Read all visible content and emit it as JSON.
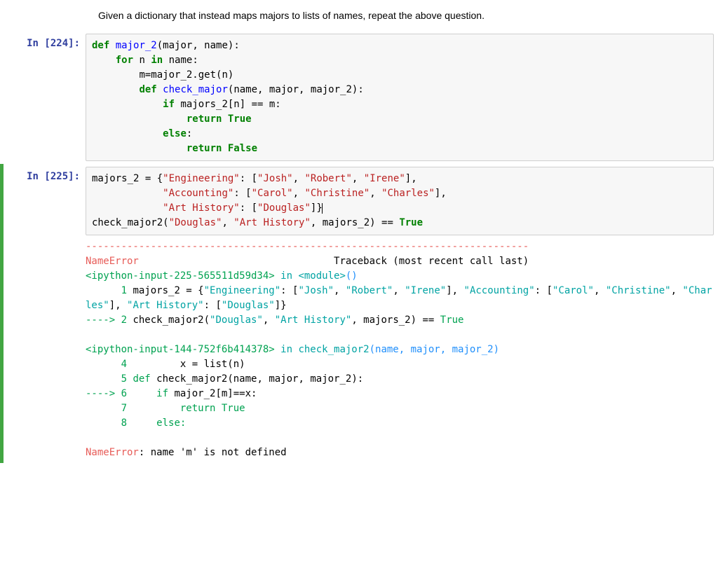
{
  "text_cell": "Given a dictionary that instead maps majors to lists of names, repeat the above question.",
  "cell224": {
    "prompt_label": "In [",
    "prompt_num": "224",
    "prompt_close": "]:",
    "line1": {
      "def": "def",
      "fn": "major_2",
      "rest": "(major, name):"
    },
    "line2": {
      "for": "for",
      "n": "n",
      "in": "in",
      "rest": " name:"
    },
    "line3": "m=major_2.get(n)",
    "line4": {
      "def": "def",
      "fn": "check_major",
      "rest": "(name, major, major_2):"
    },
    "line5": {
      "if": "if",
      "rest": " majors_2[n] == m:"
    },
    "line6": {
      "ret": "return",
      "true": "True"
    },
    "line7": {
      "else": "else",
      "colon": ":"
    },
    "line8": {
      "ret": "return",
      "false": "False"
    }
  },
  "cell225": {
    "prompt_label": "In [",
    "prompt_num": "225",
    "prompt_close": "]:",
    "l1_a": "majors_2 = {",
    "l1_eng": "\"Engineering\"",
    "l1_sep": ": [",
    "l1_josh": "\"Josh\"",
    "l1_c1": ", ",
    "l1_rob": "\"Robert\"",
    "l1_c2": ", ",
    "l1_ire": "\"Irene\"",
    "l1_end": "],",
    "l2_pad": "            ",
    "l2_acc": "\"Accounting\"",
    "l2_sep": ": [",
    "l2_car": "\"Carol\"",
    "l2_c1": ", ",
    "l2_chr": "\"Christine\"",
    "l2_c2": ", ",
    "l2_cha": "\"Charles\"",
    "l2_end": "],",
    "l3_pad": "            ",
    "l3_art": "\"Art History\"",
    "l3_sep": ": [",
    "l3_dou": "\"Douglas\"",
    "l3_end": "]}",
    "l4_a": "check_major2(",
    "l4_dou": "\"Douglas\"",
    "l4_c1": ", ",
    "l4_art": "\"Art History\"",
    "l4_rest": ", majors_2) == ",
    "l4_true": "True"
  },
  "tb": {
    "dashes": "---------------------------------------------------------------------------",
    "err_name": "NameError",
    "err_trace_pre": "                                 ",
    "err_trace": "Traceback (most recent call last)",
    "loc1_a": "<ipython-input-225-565511d59d34>",
    "loc1_in": " in ",
    "loc1_mod": "<module>",
    "loc1_p": "()",
    "l1_num": "      1",
    "l1_code_a": " majors_2 = {",
    "l1_eng": "\"Engineering\"",
    "l1_sep1": ": [",
    "l1_josh": "\"Josh\"",
    "l1_c1": ", ",
    "l1_rob": "\"Robert\"",
    "l1_c2": ", ",
    "l1_ire": "\"Irene\"",
    "l1_c3": "], ",
    "l1_acc": "\"Accounting\"",
    "l1_sep2": ": [",
    "l1_car": "\"Carol\"",
    "l1_c4": ", ",
    "l1_chr": "\"Christine\"",
    "l1_c5": ", ",
    "l1_cha": "\"Charles\"",
    "l1_c6": "], ",
    "l1_art": "\"Art History\"",
    "l1_sep3": ": [",
    "l1_dou": "\"Douglas\"",
    "l1_end": "]}",
    "arrow2": "----> 2",
    "l2_a": " check_major2(",
    "l2_dou": "\"Douglas\"",
    "l2_c1": ", ",
    "l2_art": "\"Art History\"",
    "l2_rest": ", majors_2) == ",
    "l2_true": "True",
    "loc2_a": "<ipython-input-144-752f6b414378>",
    "loc2_in": " in ",
    "loc2_fn": "check_major2",
    "loc2_args": "(name, major, major_2)",
    "l4_num": "      4",
    "l4_code": "         x = list(n)",
    "l5_num": "      5",
    "l5_def": " def ",
    "l5_fn": "check_major2",
    "l5_args": "(name, major, major_2):",
    "arrow6": "----> 6",
    "l6_if": "     if ",
    "l6_a": "major_2[m]==x:",
    "l7_num": "      7",
    "l7_ret": "         return ",
    "l7_true": "True",
    "l8_num": "      8",
    "l8_else": "     else:",
    "final_err": "NameError",
    "final_msg": ": name 'm' is not defined"
  }
}
